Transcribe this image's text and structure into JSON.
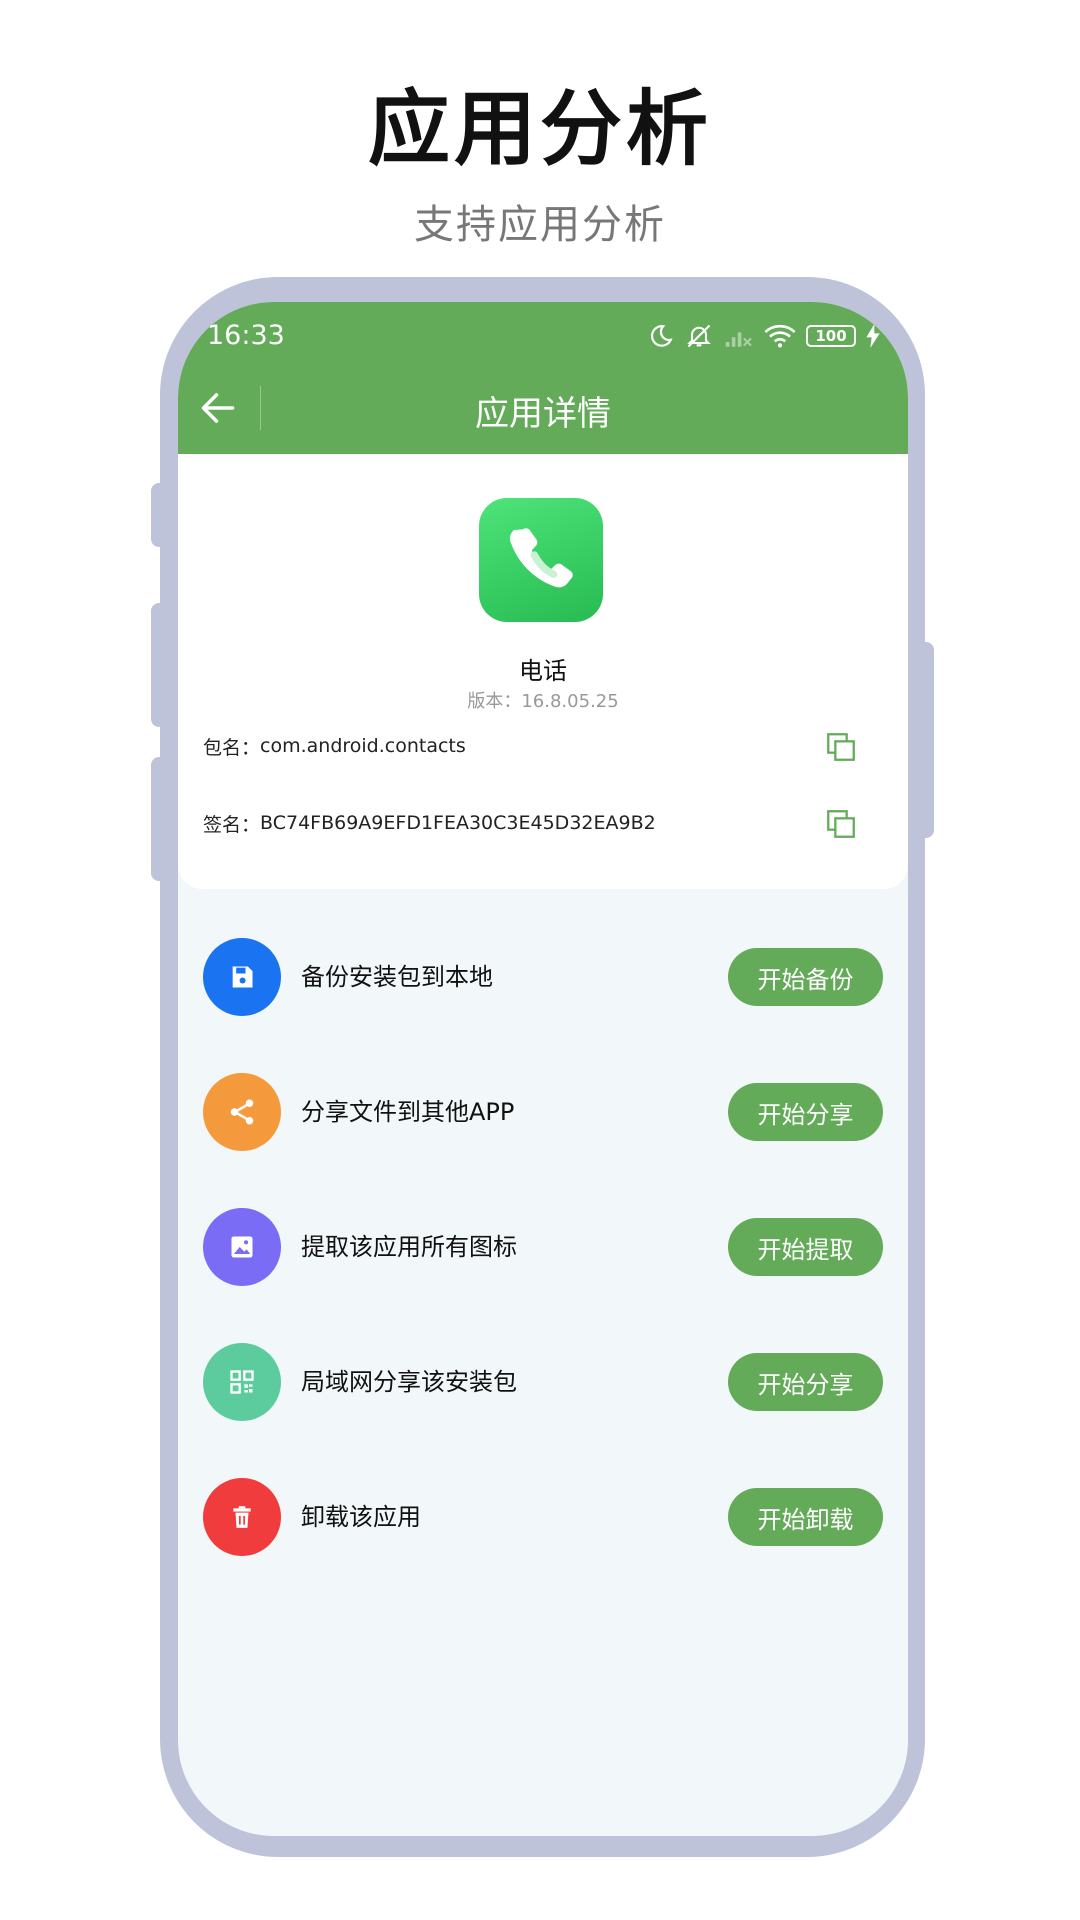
{
  "hero": {
    "title": "应用分析",
    "subtitle": "支持应用分析"
  },
  "status_bar": {
    "time": "16:33",
    "battery": "100",
    "icons": [
      "moon-icon",
      "mute-icon",
      "signal-icon",
      "wifi-icon",
      "battery-icon",
      "charging-icon"
    ]
  },
  "header": {
    "title": "应用详情",
    "back_icon": "arrow-left-icon"
  },
  "app": {
    "name": "电话",
    "version": "版本：16.8.05.25",
    "package_label": "包名：",
    "package_value": "com.android.contacts",
    "signature_label": "签名：",
    "signature_value": "BC74FB69A9EFD1FEA30C3E45D32EA9B2"
  },
  "actions": [
    {
      "label": "备份安装包到本地",
      "button": "开始备份",
      "icon": "save-icon",
      "color": "#1a73f0"
    },
    {
      "label": "分享文件到其他APP",
      "button": "开始分享",
      "icon": "share-icon",
      "color": "#f59a3c"
    },
    {
      "label": "提取该应用所有图标",
      "button": "开始提取",
      "icon": "image-icon",
      "color": "#7b6cf6"
    },
    {
      "label": "局域网分享该安装包",
      "button": "开始分享",
      "icon": "qr-code-icon",
      "color": "#5ccb9d"
    },
    {
      "label": "卸载该应用",
      "button": "开始卸载",
      "icon": "trash-icon",
      "color": "#f03c3c"
    }
  ],
  "colors": {
    "accent": "#63ab58",
    "frame": "#bfc3da",
    "screen_bg": "#f2f7fa"
  }
}
